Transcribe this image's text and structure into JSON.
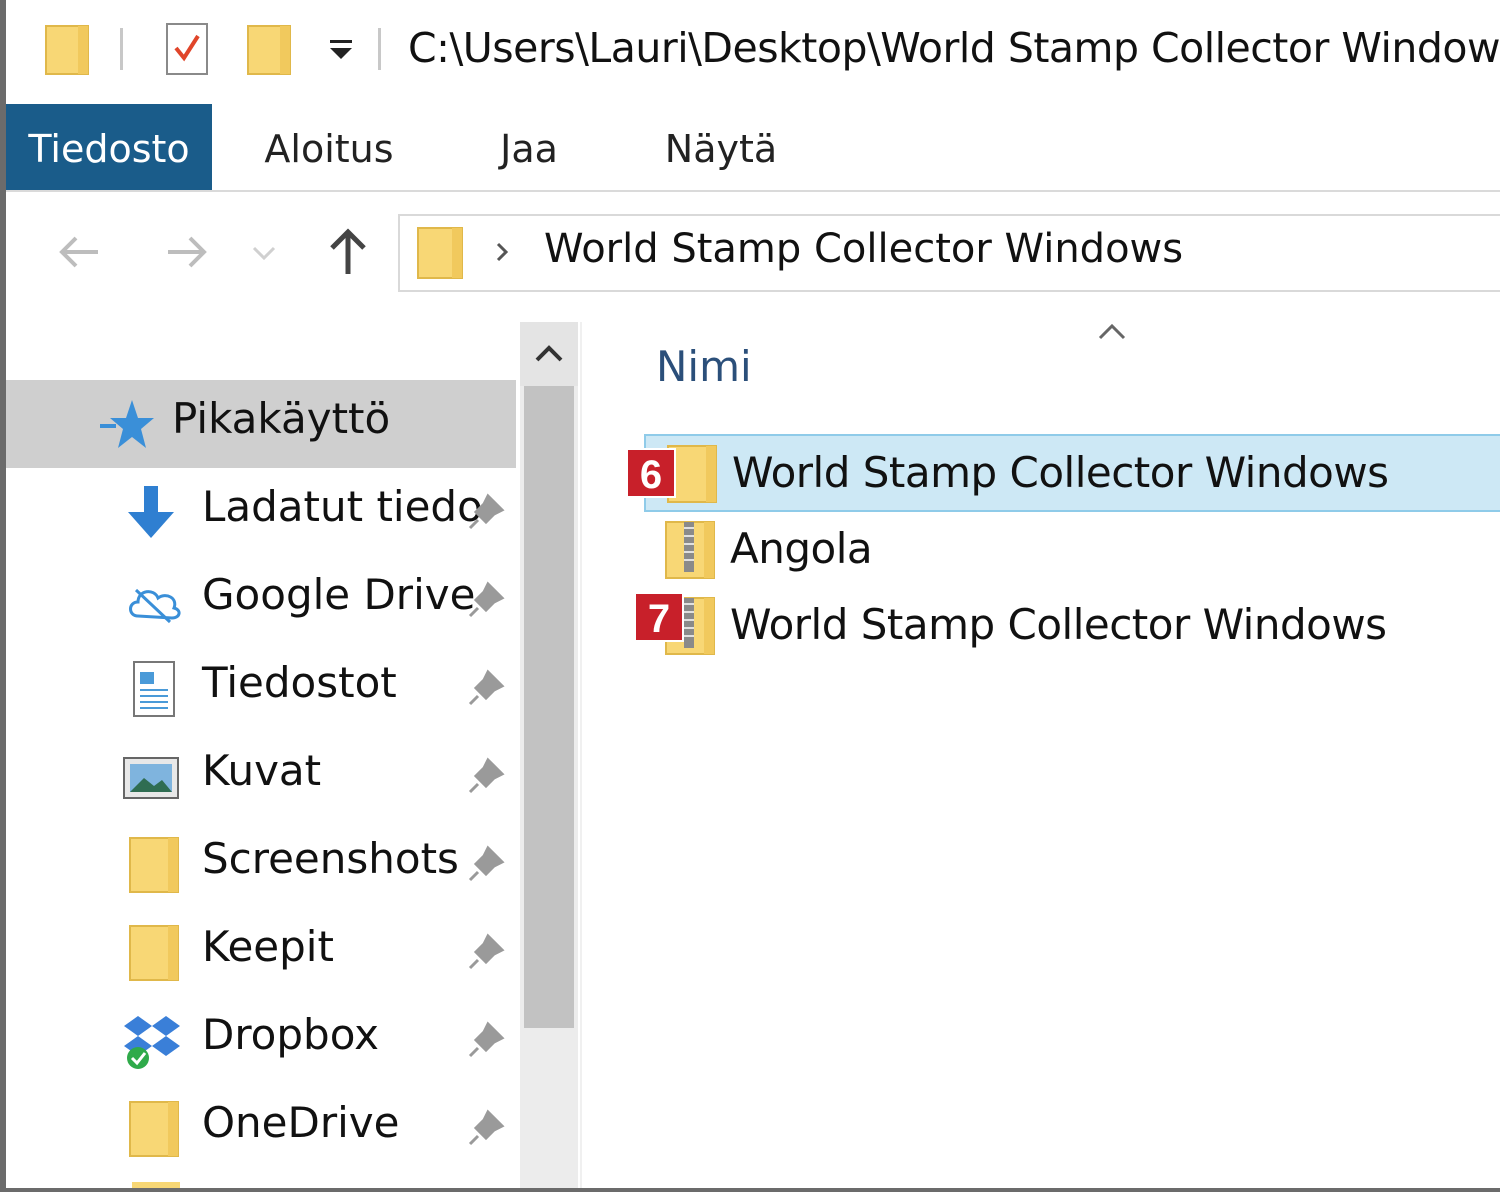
{
  "title_bar": {
    "path": "C:\\Users\\Lauri\\Desktop\\World Stamp Collector Windows"
  },
  "ribbon": {
    "tabs": [
      {
        "label": "Tiedosto",
        "active": true
      },
      {
        "label": "Aloitus",
        "active": false
      },
      {
        "label": "Jaa",
        "active": false
      },
      {
        "label": "Näytä",
        "active": false
      }
    ]
  },
  "address_bar": {
    "segment": "World Stamp Collector Windows"
  },
  "sidebar": {
    "items": [
      {
        "label": "Pikakäyttö",
        "icon": "star-icon",
        "pinned": false,
        "selected": true
      },
      {
        "label": "Ladatut tiedo",
        "icon": "download-icon",
        "pinned": true
      },
      {
        "label": "Google Drive",
        "icon": "cloud-icon",
        "pinned": true
      },
      {
        "label": "Tiedostot",
        "icon": "document-icon",
        "pinned": true
      },
      {
        "label": "Kuvat",
        "icon": "picture-icon",
        "pinned": true
      },
      {
        "label": "Screenshots",
        "icon": "folder-icon",
        "pinned": true
      },
      {
        "label": "Keepit",
        "icon": "folder-icon",
        "pinned": true
      },
      {
        "label": "Dropbox",
        "icon": "dropbox-icon",
        "pinned": true
      },
      {
        "label": "OneDrive",
        "icon": "folder-icon",
        "pinned": true
      }
    ]
  },
  "content": {
    "column_header": "Nimi",
    "files": [
      {
        "label": "World Stamp Collector Windows",
        "icon": "folder-icon",
        "badge": "6",
        "selected": true
      },
      {
        "label": "Angola",
        "icon": "zip-folder-icon",
        "badge": "",
        "selected": false
      },
      {
        "label": "World Stamp Collector Windows",
        "icon": "zip-folder-icon",
        "badge": "7",
        "selected": false
      }
    ]
  },
  "colors": {
    "active_tab": "#1a5c8a",
    "selection": "#cde8f5",
    "badge": "#c8202a",
    "folder": "#f8d775"
  }
}
